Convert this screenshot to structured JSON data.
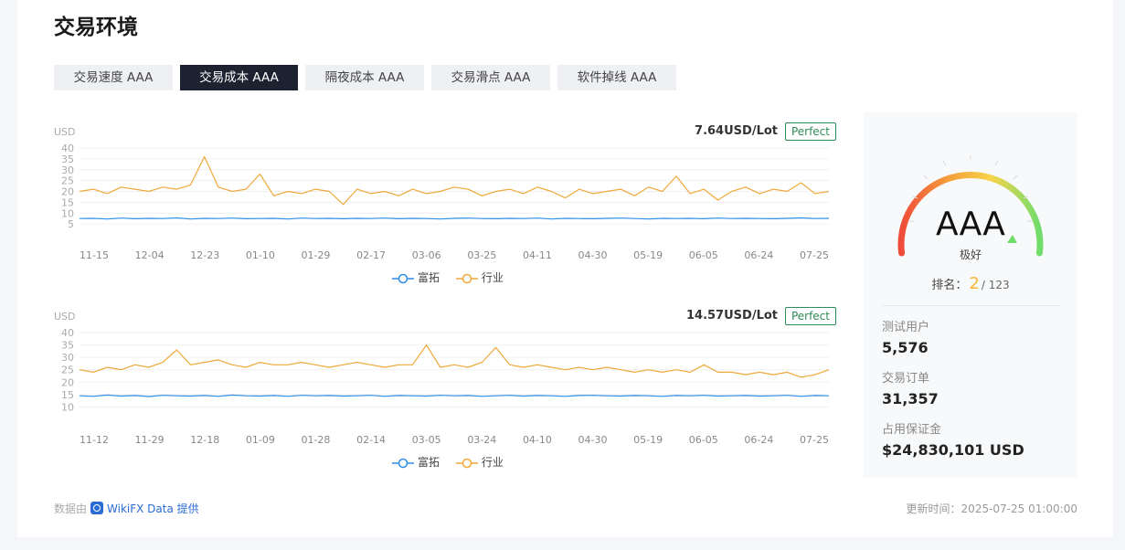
{
  "header": {
    "title": "交易环境"
  },
  "tabs": [
    {
      "label": "交易速度 AAA",
      "active": false
    },
    {
      "label": "交易成本 AAA",
      "active": true
    },
    {
      "label": "隔夜成本 AAA",
      "active": false
    },
    {
      "label": "交易滑点 AAA",
      "active": false
    },
    {
      "label": "软件掉线 AAA",
      "active": false
    }
  ],
  "charts": [
    {
      "unit": "USD",
      "value_label": "7.64USD/Lot",
      "badge": "Perfect",
      "legend": [
        "富拓",
        "行业"
      ]
    },
    {
      "unit": "USD",
      "value_label": "14.57USD/Lot",
      "badge": "Perfect",
      "legend": [
        "富拓",
        "行业"
      ]
    }
  ],
  "chart_data": [
    {
      "type": "line",
      "ylim": [
        0,
        40
      ],
      "yticks": [
        "40",
        "35",
        "30",
        "25",
        "20",
        "15",
        "10",
        "5"
      ],
      "xticks": [
        "11-15",
        "12-04",
        "12-23",
        "01-10",
        "01-29",
        "02-17",
        "03-06",
        "03-25",
        "04-11",
        "04-30",
        "05-19",
        "06-05",
        "06-24",
        "07-25"
      ],
      "series": [
        {
          "name": "富拓",
          "color": "#2e8ee6",
          "values": [
            7.5,
            7.6,
            7.3,
            7.7,
            7.4,
            7.6,
            7.5,
            7.8,
            7.3,
            7.6,
            7.5,
            7.7,
            7.4,
            7.5,
            7.6,
            7.3,
            7.7,
            7.5,
            7.6,
            7.4,
            7.6,
            7.5,
            7.7,
            7.4,
            7.6,
            7.5,
            7.3,
            7.6,
            7.7,
            7.5,
            7.4,
            7.6,
            7.5,
            7.7,
            7.3,
            7.6,
            7.5,
            7.4,
            7.6,
            7.7,
            7.5,
            7.3,
            7.6,
            7.5,
            7.6,
            7.4,
            7.7,
            7.5,
            7.6,
            7.5,
            7.4,
            7.6,
            7.8,
            7.5,
            7.6
          ]
        },
        {
          "name": "行业",
          "color": "#eea93a",
          "values": [
            20,
            21,
            19,
            22,
            21,
            20,
            22,
            21,
            23,
            36,
            22,
            20,
            21,
            28,
            18,
            20,
            19,
            21,
            20,
            14,
            21,
            19,
            20,
            18,
            21,
            19,
            20,
            22,
            21,
            18,
            20,
            21,
            19,
            22,
            20,
            17,
            21,
            19,
            20,
            21,
            18,
            22,
            20,
            27,
            19,
            21,
            16,
            20,
            22,
            19,
            21,
            20,
            24,
            19,
            20
          ]
        }
      ]
    },
    {
      "type": "line",
      "ylim": [
        5,
        40
      ],
      "yticks": [
        "40",
        "35",
        "30",
        "25",
        "20",
        "15",
        "10"
      ],
      "xticks": [
        "11-12",
        "11-29",
        "12-18",
        "01-09",
        "01-28",
        "02-14",
        "03-05",
        "03-24",
        "04-10",
        "04-30",
        "05-19",
        "06-05",
        "06-24",
        "07-25"
      ],
      "series": [
        {
          "name": "富拓",
          "color": "#2e8ee6",
          "values": [
            14.5,
            14.3,
            14.8,
            14.4,
            14.6,
            14.2,
            14.7,
            14.5,
            14.4,
            14.6,
            14.3,
            14.8,
            14.5,
            14.4,
            14.6,
            14.3,
            14.7,
            14.5,
            14.6,
            14.4,
            14.5,
            14.7,
            14.3,
            14.6,
            14.5,
            14.4,
            14.7,
            14.5,
            14.6,
            14.3,
            14.5,
            14.7,
            14.4,
            14.6,
            14.5,
            14.3,
            14.6,
            14.7,
            14.5,
            14.4,
            14.6,
            14.5,
            14.3,
            14.6,
            14.5,
            14.7,
            14.4,
            14.5,
            14.6,
            14.4,
            14.5,
            14.7,
            14.3,
            14.6,
            14.5
          ]
        },
        {
          "name": "行业",
          "color": "#eea93a",
          "values": [
            25,
            24,
            26,
            25,
            27,
            26,
            28,
            33,
            27,
            28,
            29,
            27,
            26,
            28,
            27,
            27,
            28,
            27,
            26,
            27,
            28,
            27,
            26,
            27,
            27,
            35,
            26,
            27,
            26,
            28,
            34,
            27,
            26,
            27,
            26,
            25,
            26,
            25,
            26,
            25,
            24,
            25,
            24,
            25,
            24,
            27,
            24,
            24,
            23,
            24,
            23,
            24,
            22,
            23,
            25
          ]
        }
      ]
    }
  ],
  "score": {
    "grade": "AAA",
    "label": "极好",
    "rank_label": "排名：",
    "rank": "2",
    "rank_total": "/ 123"
  },
  "stats": [
    {
      "label": "测试用户",
      "value": "5,576"
    },
    {
      "label": "交易订单",
      "value": "31,357"
    },
    {
      "label": "占用保证金",
      "value": "$24,830,101 USD"
    }
  ],
  "footer": {
    "source_prefix": "数据由",
    "source_brand": "WikiFX Data",
    "source_suffix": "提供",
    "updated": "更新时间：2025-07-25 01:00:00"
  },
  "colors": {
    "accent_dark": "#1c2230",
    "badge_green": "#2e8b57",
    "rank_yellow": "#f5b632",
    "series_blue": "#2e8ee6",
    "series_orange": "#eea93a"
  }
}
